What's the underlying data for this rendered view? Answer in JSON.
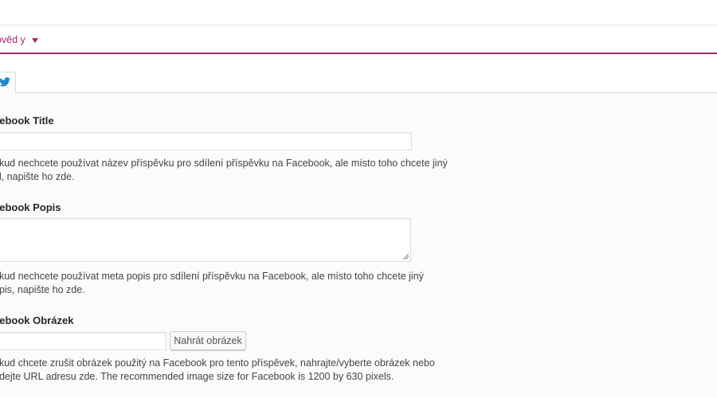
{
  "help": {
    "label": "pověd y"
  },
  "tabs": {
    "twitter_icon": "twitter-icon"
  },
  "fields": {
    "title": {
      "label": "cebook Title",
      "value": "",
      "desc_line1": "okud nechcete používat název příspěvku pro sdílení příspěvku na Facebook, ale místo toho chcete jiný",
      "desc_line2": "ul, napište ho zde."
    },
    "popis": {
      "label": "cebook Popis",
      "value": "",
      "desc_line1": "okud nechcete používat meta popis pro sdílení příspěvku na Facebook, ale místo toho chcete jiný",
      "desc_line2": "opis, napište ho zde."
    },
    "obrazek": {
      "label": "cebook Obrázek",
      "value": "",
      "button": "Nahrát obrázek",
      "desc_line1": "okud chcete zrušit obrázek použitý na Facebook pro tento příspěvek, nahrajte/vyberte obrázek nebo",
      "desc_line2": "ridejte URL adresu zde. The recommended image size for Facebook is 1200 by 630 pixels."
    }
  },
  "colors": {
    "accent": "#a4286a",
    "twitter": "#1da1f2"
  }
}
